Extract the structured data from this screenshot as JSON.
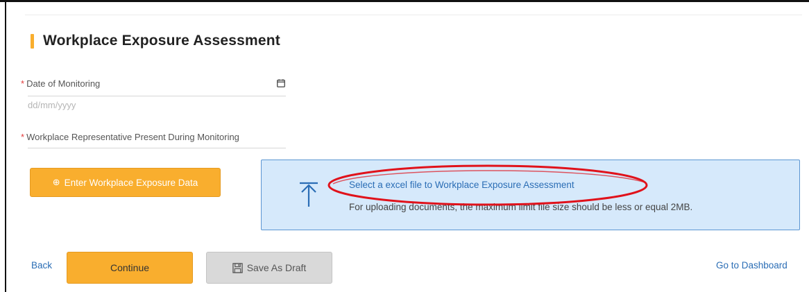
{
  "section": {
    "title": "Workplace Exposure Assessment",
    "accent_color": "#f9ae2e"
  },
  "fields": {
    "date": {
      "required_mark": "*",
      "label": "Date of Monitoring",
      "placeholder": "dd/mm/yyyy",
      "icon": "calendar-icon"
    },
    "representative": {
      "required_mark": "*",
      "label": "Workplace Representative Present During Monitoring"
    }
  },
  "actions": {
    "enter_data_icon": "⊕",
    "enter_data_label": "Enter Workplace Exposure Data",
    "back_label": "Back",
    "continue_label": "Continue",
    "save_draft_label": "Save As Draft",
    "dashboard_label": "Go to Dashboard"
  },
  "upload": {
    "link_text": "Select a excel file to Workplace Exposure Assessment",
    "note": "For uploading documents, the maximum limit file size should be less or equal 2MB.",
    "icon": "upload-icon",
    "box_color": "#d6e9fb",
    "highlight_color": "#e0121b"
  },
  "colors": {
    "primary_button": "#f9ae2e",
    "link": "#2a6db5",
    "required": "#e23b3b"
  }
}
